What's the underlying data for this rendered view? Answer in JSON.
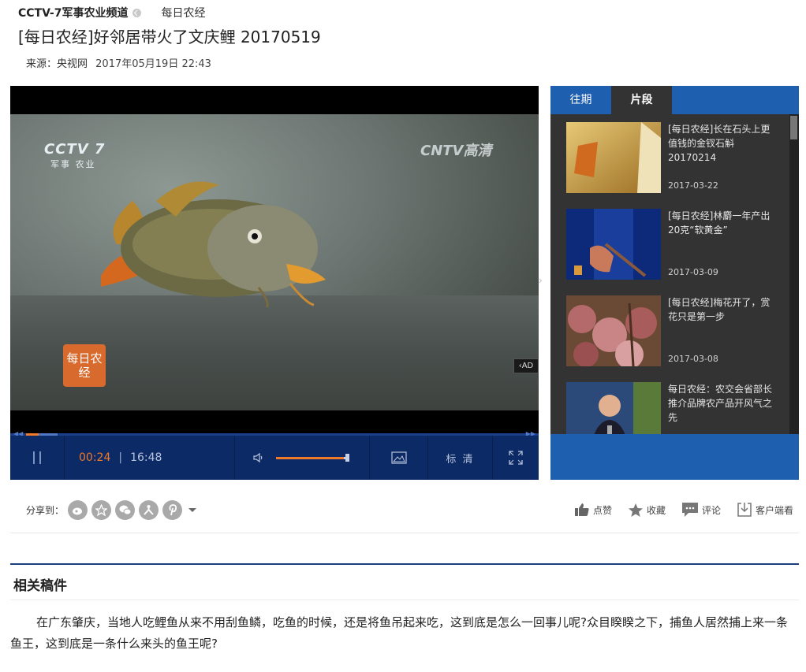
{
  "breadcrumb": {
    "channel": "CCTV-7军事农业频道",
    "program": "每日农经"
  },
  "article": {
    "title": "[每日农经]好邻居带火了文庆鲤 20170519",
    "source": "来源：央视网",
    "datetime": "2017年05月19日 22:43"
  },
  "player": {
    "watermark_left": "CCTV 7",
    "watermark_left_sub": "军事 农业",
    "watermark_right": "CNTV高清",
    "show_logo": "每日农经",
    "ad_label": "AD",
    "current_time": "00:24",
    "time_separator": "|",
    "duration": "16:48",
    "quality": "标 清",
    "volume_fraction": 0.95,
    "progress_fraction": 0.024
  },
  "panel": {
    "tabs": [
      {
        "label": "往期"
      },
      {
        "label": "片段"
      }
    ],
    "items": [
      {
        "title": "[每日农经]长在石头上更值钱的金钗石斛 20170214",
        "date": "2017-03-22"
      },
      {
        "title": "[每日农经]林麝一年产出20克“软黄金”",
        "date": "2017-03-09"
      },
      {
        "title": "[每日农经]梅花开了，赏花只是第一步",
        "date": "2017-03-08"
      },
      {
        "title": "每日农经：农交会省部长推介品牌农产品开风气之先",
        "date": ""
      }
    ]
  },
  "share": {
    "label": "分享到：",
    "icons": [
      "weibo-icon",
      "qzone-icon",
      "wechat-icon",
      "renren-icon",
      "pinterest-icon"
    ]
  },
  "actions": {
    "like": "点赞",
    "favorite": "收藏",
    "comment": "评论",
    "client": "客户端看"
  },
  "related": {
    "heading": "相关稿件",
    "body": "在广东肇庆，当地人吃鲤鱼从来不用刮鱼鳞，吃鱼的时候，还是将鱼吊起来吃，这到底是怎么一回事儿呢?众目睽睽之下，捕鱼人居然捕上来一条鱼王，这到底是一条什么来头的鱼王呢?"
  },
  "colors": {
    "player_bar": "#0c2a66",
    "tab_blue": "#1f5fb0",
    "accent_orange": "#f07a28",
    "panel_bg": "#333333"
  }
}
